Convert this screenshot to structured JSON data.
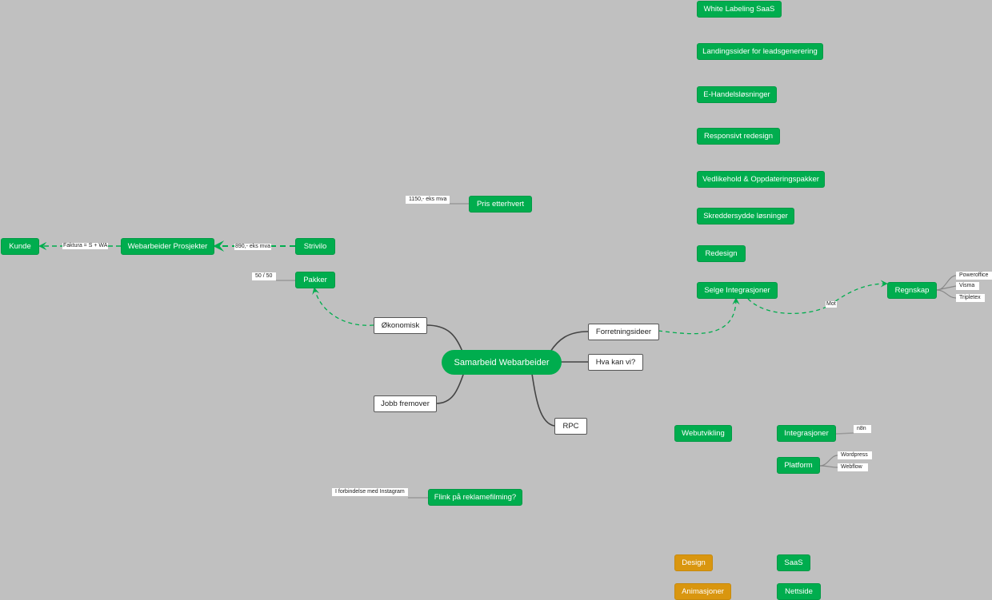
{
  "central": {
    "label": "Samarbeid Webarbeider"
  },
  "branches": {
    "okonomisk": "Økonomisk",
    "jobb_fremover": "Jobb fremover",
    "forretningsideer": "Forretningsideer",
    "hva_kan_vi": "Hva kan vi?",
    "rpc": "RPC"
  },
  "flow": {
    "kunde": "Kunde",
    "webarbeider_prosjekter": "Webarbeider Prosjekter",
    "strivilo": "Strivilo",
    "edge_faktura": "Faktura = S + WA",
    "edge_strivilo": "890,- eks mva"
  },
  "pris": {
    "label": "Pris etterhvert",
    "tag": "1150,- eks mva"
  },
  "pakker": {
    "label": "Pakker",
    "tag": "50 / 50"
  },
  "reklame": {
    "label": "Flink på reklamefilming?",
    "tag": "I forbindelse med Instagram"
  },
  "ideas": [
    "White Labeling SaaS",
    "Landingssider for leadsgenerering",
    "E-Handelsløsninger",
    "Responsivt redesign",
    "Vedlikehold & Oppdateringspakker",
    "Skreddersydde løsninger",
    "Redesign",
    "Selge Integrasjoner"
  ],
  "regnskap": {
    "label": "Regnskap",
    "edge_label": "Mot",
    "tags": [
      "Poweroffice",
      "Visma",
      "Tripletex"
    ]
  },
  "webutvikling": {
    "label": "Webutvikling"
  },
  "integrasjoner": {
    "label": "Integrasjoner",
    "tag": "n8n"
  },
  "platform": {
    "label": "Platform",
    "tags": [
      "Wordpress",
      "Webflow"
    ]
  },
  "design": "Design",
  "animasjoner": "Animasjoner",
  "saas": "SaaS",
  "nettside": "Nettside",
  "colors": {
    "background": "#c0c0c0",
    "node_green": "#00ad4e",
    "node_orange": "#d9960f",
    "connector_dark": "#444444",
    "connector_dashed": "#00ad4e"
  }
}
